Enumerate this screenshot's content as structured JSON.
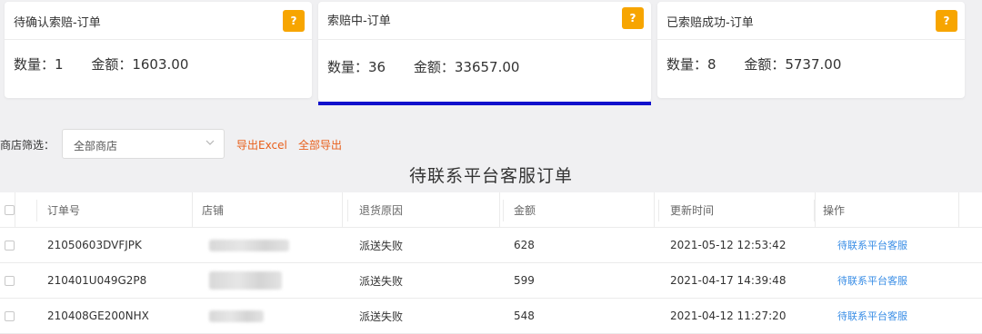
{
  "cards": [
    {
      "title": "待确认索赔-订单",
      "help": "?",
      "count_text": "数量：1",
      "amount_text": "金额：1603.00"
    },
    {
      "title": "索赔中-订单",
      "help": "?",
      "count_text": "数量：36",
      "amount_text": "金额：33657.00",
      "active": true
    },
    {
      "title": "已索赔成功-订单",
      "help": "?",
      "count_text": "数量：8",
      "amount_text": "金额：5737.00"
    }
  ],
  "filter": {
    "label": "商店筛选：",
    "select_value": "全部商店",
    "export_excel": "导出Excel",
    "export_all": "全部导出"
  },
  "section_title": "待联系平台客服订单",
  "table": {
    "headers": [
      "订单号",
      "店铺",
      "退货原因",
      "金额",
      "更新时间",
      "操作"
    ],
    "rows": [
      {
        "order": "21050603DVFJPK",
        "reason": "派送失败",
        "amount": "628",
        "time": "2021-05-12 12:53:42",
        "action": "待联系平台客服"
      },
      {
        "order": "210401U049G2P8",
        "reason": "派送失败",
        "amount": "599",
        "time": "2021-04-17 14:39:48",
        "action": "待联系平台客服"
      },
      {
        "order": "210408GE200NHX",
        "reason": "派送失败",
        "amount": "548",
        "time": "2021-04-12 11:27:20",
        "action": "待联系平台客服"
      }
    ]
  },
  "colors": {
    "help_badge": "#f7a500",
    "active_bar": "#1010cc",
    "export_link": "#e8601c",
    "action_link": "#3a8ee6"
  },
  "icons": {
    "help": "help-icon",
    "select_arrow": "chevron-down-icon",
    "checkbox": "checkbox-icon"
  }
}
